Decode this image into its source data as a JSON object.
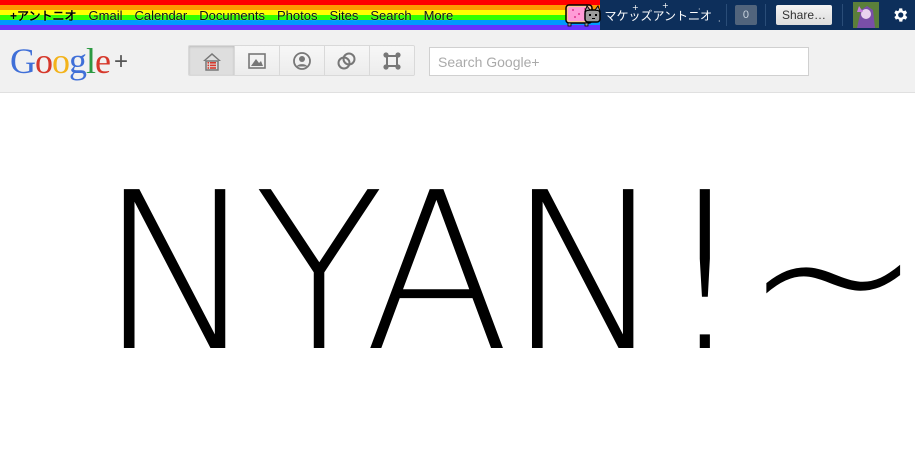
{
  "topbar": {
    "nav": [
      {
        "label": "+アントニオ",
        "kind": "user"
      },
      {
        "label": "Gmail"
      },
      {
        "label": "Calendar"
      },
      {
        "label": "Documents"
      },
      {
        "label": "Photos"
      },
      {
        "label": "Sites"
      },
      {
        "label": "Search"
      },
      {
        "label": "More"
      }
    ],
    "user_name": "マケッズアントニオ",
    "notification_count": "0",
    "share_label": "Share…",
    "gear_icon": "gear-icon"
  },
  "header": {
    "logo_text": "Google",
    "logo_plus": "+",
    "nav_icons": [
      "home-icon",
      "photos-icon",
      "profile-icon",
      "circles-icon",
      "games-icon"
    ],
    "search_placeholder": "Search Google+"
  },
  "main": {
    "big_text": "NYAN!~"
  },
  "colors": {
    "topbar_night": "#0d2f5b",
    "header_bg": "#f1f1f1",
    "logo_blue": "#3f6fd8",
    "logo_red": "#d6382b",
    "logo_yellow": "#f3b31b",
    "logo_green": "#2c9a42"
  }
}
